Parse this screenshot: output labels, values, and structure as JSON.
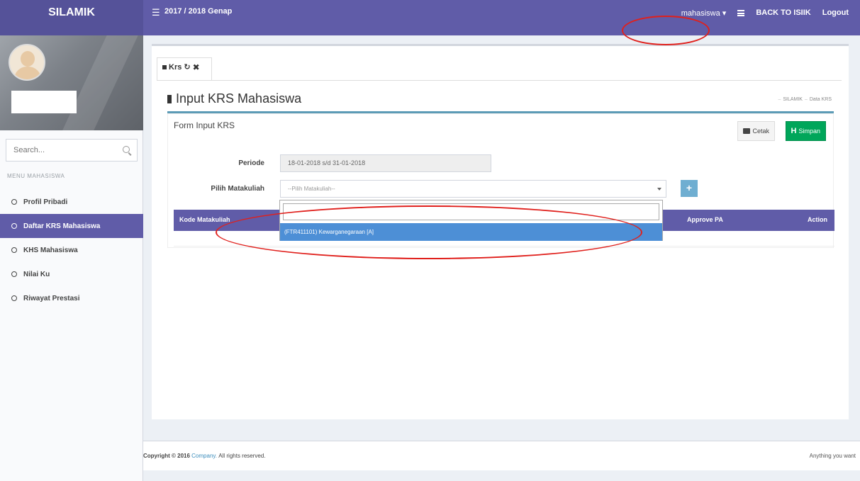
{
  "app": {
    "name": "SILAMIK",
    "period": "2017 / 2018 Genap"
  },
  "topnav": {
    "user": "mahasiswa",
    "back_label": "BACK TO ISIIK",
    "logout_label": "Logout"
  },
  "sidebar": {
    "search_placeholder": "Search...",
    "menu_header": "MENU MAHASISWA",
    "items": [
      {
        "label": "Profil Pribadi"
      },
      {
        "label": "Daftar KRS Mahasiswa"
      },
      {
        "label": "KHS Mahasiswa"
      },
      {
        "label": "Nilai Ku"
      },
      {
        "label": "Riwayat Prestasi"
      }
    ],
    "active_index": 1
  },
  "tab": {
    "label": "Krs"
  },
  "page": {
    "title": "Input KRS Mahasiswa"
  },
  "breadcrumb": {
    "root": "SILAMIK",
    "current": "Data KRS"
  },
  "form": {
    "title": "Form Input KRS",
    "cetak_label": "Cetak",
    "simpan_label": "Simpan",
    "periode_label": "Periode",
    "periode_value": "18-01-2018 s/d 31-01-2018",
    "matakuliah_label": "Pilih Matakuliah",
    "matakuliah_placeholder": "--Pilih Matakuliah--",
    "add_label": "+"
  },
  "table": {
    "columns": {
      "kode": "Kode Matakuliah",
      "approve": "Approve PA",
      "action": "Action"
    }
  },
  "dropdown": {
    "search_value": "",
    "options": [
      "(FTR411101) Kewarganegaraan [A]"
    ]
  },
  "footer": {
    "copyright": "Copyright © 2016",
    "company": "Company.",
    "rights": "All rights reserved.",
    "right_text": "Anything you want"
  },
  "colors": {
    "primary": "#605ca8",
    "success": "#00a65a",
    "highlight": "#4d8fd6",
    "annotation": "#e0201c"
  }
}
